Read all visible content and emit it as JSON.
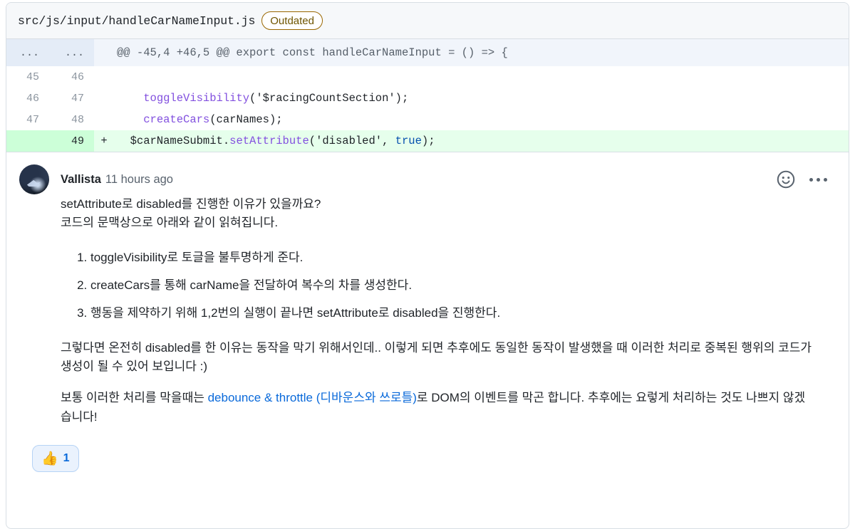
{
  "file_header": {
    "path": "src/js/input/handleCarNameInput.js",
    "badge": "Outdated"
  },
  "diff": {
    "hunk_header": "@@ -45,4 +46,5 @@ export const handleCarNameInput = () => {",
    "hunk_gutter_left": "...",
    "hunk_gutter_right": "...",
    "rows": [
      {
        "old_line": "45",
        "new_line": "46",
        "marker": "",
        "type": "context",
        "code": ""
      },
      {
        "old_line": "46",
        "new_line": "47",
        "marker": "",
        "type": "context",
        "code": "    toggleVisibility('$racingCountSection');",
        "tokens": [
          {
            "t": "    ",
            "c": "plain"
          },
          {
            "t": "toggleVisibility",
            "c": "fn"
          },
          {
            "t": "('$racingCountSection');",
            "c": "plain"
          }
        ]
      },
      {
        "old_line": "47",
        "new_line": "48",
        "marker": "",
        "type": "context",
        "code": "    createCars(carNames);",
        "tokens": [
          {
            "t": "    ",
            "c": "plain"
          },
          {
            "t": "createCars",
            "c": "fn"
          },
          {
            "t": "(carNames);",
            "c": "plain"
          }
        ]
      },
      {
        "old_line": "",
        "new_line": "49",
        "marker": "+",
        "type": "addition",
        "code": "    $carNameSubmit.setAttribute('disabled', true);",
        "tokens": [
          {
            "t": "  $carNameSubmit.",
            "c": "plain"
          },
          {
            "t": "setAttribute",
            "c": "fn"
          },
          {
            "t": "('disabled', ",
            "c": "plain"
          },
          {
            "t": "true",
            "c": "kw"
          },
          {
            "t": ");",
            "c": "plain"
          }
        ]
      }
    ]
  },
  "comment": {
    "author": "Vallista",
    "timestamp": "11 hours ago",
    "emoji_button_icon": "smiley-icon",
    "menu_button_icon": "kebab-menu-icon",
    "paragraph_1_line_1": "setAttribute로 disabled를 진행한 이유가 있을까요?",
    "paragraph_1_line_2": "코드의 문맥상으로 아래와 같이 읽혀집니다.",
    "list": [
      "toggleVisibility로 토글을 불투명하게 준다.",
      "createCars를 통해 carName을 전달하여 복수의 차를 생성한다.",
      "행동을 제약하기 위해 1,2번의 실행이 끝나면 setAttribute로 disabled을 진행한다."
    ],
    "paragraph_2": "그렇다면 온전히 disabled를 한 이유는 동작을 막기 위해서인데.. 이렇게 되면 추후에도 동일한 동작이 발생했을 때 이러한 처리로 중복된 행위의 코드가 생성이 될 수 있어 보입니다 :)",
    "paragraph_3_before_link": "보통 이러한 처리를 막을때는 ",
    "link_text": "debounce & throttle (디바운스와 쓰로틀)",
    "paragraph_3_after_link": "로 DOM의 이벤트를 막곤 합니다. 추후에는 요렇게 처리하는 것도 나쁘지 않겠습니다!"
  },
  "reactions": [
    {
      "emoji": "👍",
      "name": "thumbs-up",
      "count": "1"
    }
  ],
  "colors": {
    "addition_bg": "#e6ffec",
    "addition_gutter": "#ccffd8",
    "hunk_bg": "#f1f5fb",
    "link": "#0969da",
    "badge_border": "#9a6700",
    "function_token": "#8250df",
    "keyword_token": "#0550ae"
  }
}
